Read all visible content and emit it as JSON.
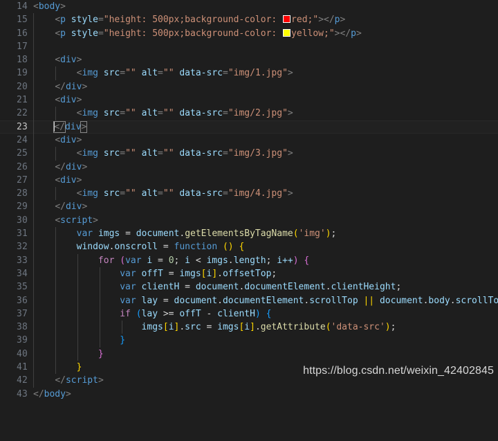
{
  "editor": {
    "theme": "dark-plus",
    "background": "#1e1e1e",
    "active_line": 23,
    "first_line": 14,
    "last_line": 43,
    "colors": {
      "background": "#1e1e1e",
      "active_line": "#212121",
      "line_number": "#6e7681",
      "line_number_active": "#c6c6c6",
      "indent_guide": "#404040",
      "tag": "#569cd6",
      "attribute": "#9cdcfe",
      "string": "#ce9178",
      "keyword": "#569cd6",
      "control": "#c586c0",
      "function": "#dcdcaa",
      "number": "#b5cea8",
      "punctuation": "#808080",
      "text": "#d4d4d4",
      "bracket_yellow": "#ffd700",
      "bracket_purple": "#da70d6",
      "bracket_blue": "#179fff",
      "swatch_red": "#ff0000",
      "swatch_yellow": "#ffff00"
    }
  },
  "lines": [
    {
      "n": "14",
      "text": "<body>"
    },
    {
      "n": "15",
      "text": "    <p style=\"height: 500px;background-color: red;\"></p>"
    },
    {
      "n": "16",
      "text": "    <p style=\"height: 500px;background-color: yellow;\"></p>"
    },
    {
      "n": "17",
      "text": ""
    },
    {
      "n": "18",
      "text": "    <div>"
    },
    {
      "n": "19",
      "text": "        <img src=\"\" alt=\"\" data-src=\"img/1.jpg\">"
    },
    {
      "n": "20",
      "text": "    </div>"
    },
    {
      "n": "21",
      "text": "    <div>"
    },
    {
      "n": "22",
      "text": "        <img src=\"\" alt=\"\" data-src=\"img/2.jpg\">"
    },
    {
      "n": "23",
      "text": "    </div>"
    },
    {
      "n": "24",
      "text": "    <div>"
    },
    {
      "n": "25",
      "text": "        <img src=\"\" alt=\"\" data-src=\"img/3.jpg\">"
    },
    {
      "n": "26",
      "text": "    </div>"
    },
    {
      "n": "27",
      "text": "    <div>"
    },
    {
      "n": "28",
      "text": "        <img src=\"\" alt=\"\" data-src=\"img/4.jpg\">"
    },
    {
      "n": "29",
      "text": "    </div>"
    },
    {
      "n": "30",
      "text": "    <script>"
    },
    {
      "n": "31",
      "text": "        var imgs = document.getElementsByTagName('img');"
    },
    {
      "n": "32",
      "text": "        window.onscroll = function () {"
    },
    {
      "n": "33",
      "text": "            for (var i = 0; i < imgs.length; i++) {"
    },
    {
      "n": "34",
      "text": "                var offT = imgs[i].offsetTop;"
    },
    {
      "n": "35",
      "text": "                var clientH = document.documentElement.clientHeight;"
    },
    {
      "n": "36",
      "text": "                var lay = document.documentElement.scrollTop || document.body.scrollTop;"
    },
    {
      "n": "37",
      "text": "                if (lay >= offT - clientH) {"
    },
    {
      "n": "38",
      "text": "                    imgs[i].src = imgs[i].getAttribute('data-src');"
    },
    {
      "n": "39",
      "text": "                }"
    },
    {
      "n": "40",
      "text": "            }"
    },
    {
      "n": "41",
      "text": "        }"
    },
    {
      "n": "42",
      "text": "    </script>"
    },
    {
      "n": "43",
      "text": "</body>"
    }
  ],
  "line_numbers": {
    "l14": "14",
    "l15": "15",
    "l16": "16",
    "l17": "17",
    "l18": "18",
    "l19": "19",
    "l20": "20",
    "l21": "21",
    "l22": "22",
    "l23": "23",
    "l24": "24",
    "l25": "25",
    "l26": "26",
    "l27": "27",
    "l28": "28",
    "l29": "29",
    "l30": "30",
    "l31": "31",
    "l32": "32",
    "l33": "33",
    "l34": "34",
    "l35": "35",
    "l36": "36",
    "l37": "37",
    "l38": "38",
    "l39": "39",
    "l40": "40",
    "l41": "41",
    "l42": "42",
    "l43": "43"
  },
  "tokens": {
    "lt": "<",
    "gt": ">",
    "lt_slash": "</",
    "body": "body",
    "p": "p",
    "div": "div",
    "img": "img",
    "script": "script",
    "style_attr": "style",
    "src_attr": "src",
    "alt_attr": "alt",
    "datasrc_attr": "data-src",
    "eq": "=",
    "quote": "\"",
    "empty_str": "\"\"",
    "style_red": "\"height: 500px;background-color: ",
    "red_name": "red",
    "yellow_name": "yellow",
    "style_tail": ";\"",
    "img1": "\"img/1.jpg\"",
    "img2": "\"img/2.jpg\"",
    "img3": "\"img/3.jpg\"",
    "img4": "\"img/4.jpg\"",
    "var": "var",
    "for": "for",
    "if": "if",
    "function": "function",
    "imgs": "imgs",
    "document": "document",
    "window": "window",
    "onscroll": "onscroll",
    "getElementsByTagName": "getElementsByTagName",
    "getAttribute": "getAttribute",
    "documentElement": "documentElement",
    "clientHeight": "clientHeight",
    "scrollTop": "scrollTop",
    "offsetTop": "offsetTop",
    "length": "length",
    "src_prop": "src",
    "body_prop": "body",
    "offT": "offT",
    "clientH": "clientH",
    "lay": "lay",
    "i": "i",
    "zero": "0",
    "str_img": "'img'",
    "str_datasrc": "'data-src'",
    "or": "||",
    "gte": ">=",
    "minus": "-",
    "lt_op": "<",
    "inc": "i++",
    "semi": ";",
    "dot": ".",
    "eq_op": "=",
    "paren_open": "(",
    "paren_close": ")",
    "brace_open": "{",
    "brace_close": "}",
    "bracket_open": "[",
    "bracket_close": "]",
    "empty_parens": "()"
  },
  "watermark": {
    "text": "https://blog.csdn.net/weixin_42402845"
  }
}
